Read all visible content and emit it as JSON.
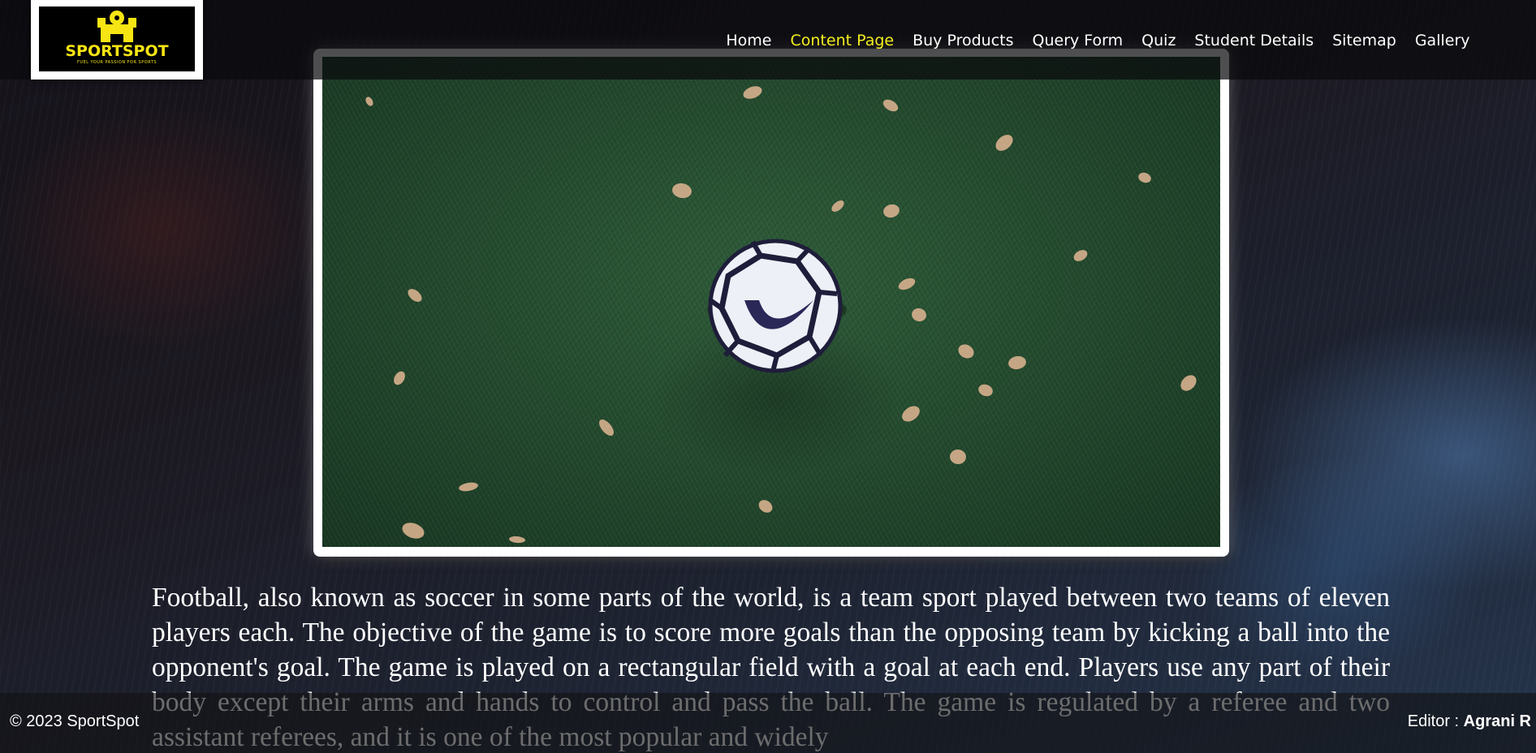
{
  "header": {
    "logo": {
      "name": "SPORTSPOT",
      "tagline": "FUEL YOUR PASSION FOR SPORTS",
      "color": "#f6e513"
    },
    "nav": [
      {
        "label": "Home",
        "active": false
      },
      {
        "label": "Content Page",
        "active": true
      },
      {
        "label": "Buy Products",
        "active": false
      },
      {
        "label": "Query Form",
        "active": false
      },
      {
        "label": "Quiz",
        "active": false
      },
      {
        "label": "Student Details",
        "active": false
      },
      {
        "label": "Sitemap",
        "active": false
      },
      {
        "label": "Gallery",
        "active": false
      }
    ],
    "active_color": "#f3ee1f"
  },
  "hero": {
    "image": "soccer-ball-on-grass-with-leaves"
  },
  "article": {
    "text": "Football, also known as soccer in some parts of the world, is a team sport played between two teams of eleven players each. The objective of the game is to score more goals than the opposing team by kicking a ball into the opponent's goal. The game is played on a rectangular field with a goal at each end. Players use any part of their body except their arms and hands to control and pass the ball. The game is regulated by a referee and two assistant referees, and it is one of the most popular and widely"
  },
  "footer": {
    "copyright": "© 2023 SportSpot",
    "editor_label": "Editor : ",
    "editor_name": "Agrani R"
  }
}
